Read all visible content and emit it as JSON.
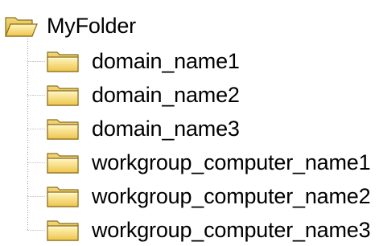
{
  "tree": {
    "root": {
      "label": "MyFolder",
      "icon": "folder-open-icon"
    },
    "children": [
      {
        "label": "domain_name1",
        "icon": "folder-icon"
      },
      {
        "label": "domain_name2",
        "icon": "folder-icon"
      },
      {
        "label": "domain_name3",
        "icon": "folder-icon"
      },
      {
        "label": "workgroup_computer_name1",
        "icon": "folder-icon"
      },
      {
        "label": "workgroup_computer_name2",
        "icon": "folder-icon"
      },
      {
        "label": "workgroup_computer_name3",
        "icon": "folder-icon"
      }
    ]
  },
  "colors": {
    "folder_body": "#f4d35e",
    "folder_light": "#fff3b0",
    "folder_outline": "#8a6d1f",
    "connector_dots": "#9a9a9a"
  }
}
